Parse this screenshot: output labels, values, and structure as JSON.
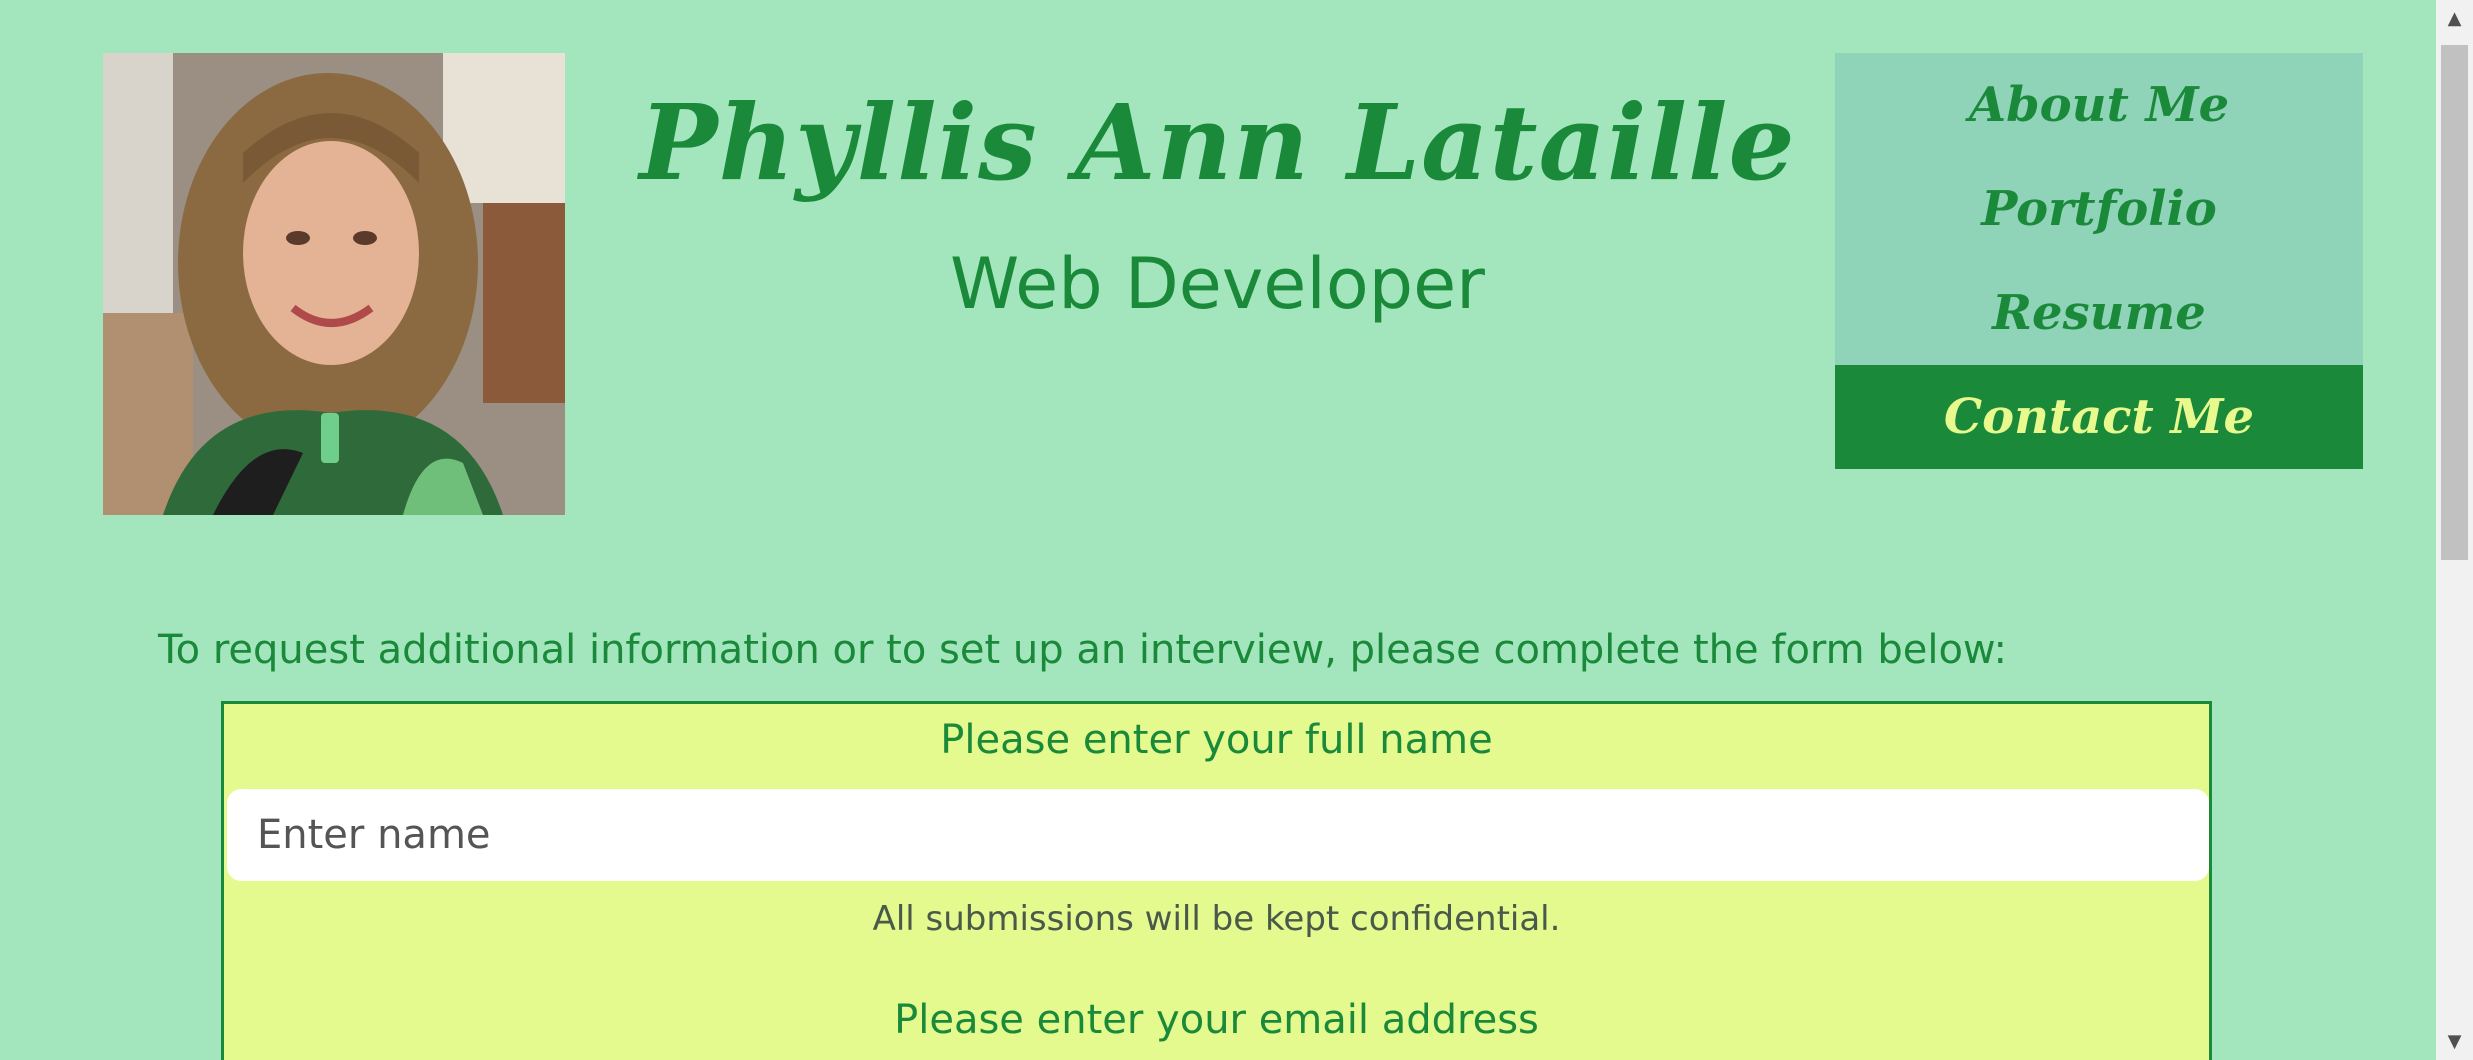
{
  "header": {
    "name": "Phyllis Ann Lataille",
    "role": "Web Developer",
    "photo_alt": "Phyllis Ann Lataille"
  },
  "nav": {
    "items": [
      {
        "label": "About Me",
        "active": false
      },
      {
        "label": "Portfolio",
        "active": false
      },
      {
        "label": "Resume",
        "active": false
      },
      {
        "label": "Contact Me",
        "active": true
      }
    ]
  },
  "intro": {
    "text": "To request additional information or to set up an interview, please complete the form below:"
  },
  "form": {
    "name_label": "Please enter your full name",
    "name_placeholder": "Enter name",
    "name_value": "",
    "help_text": "All submissions will be kept confidential.",
    "email_label": "Please enter your email address"
  },
  "colors": {
    "background": "#a3e6be",
    "accent": "#1a8a3a",
    "nav_bg": "#8fd4b8",
    "form_bg": "#e4f98e",
    "active_text": "#e8f98e"
  },
  "icons": {
    "scroll_up": "▲",
    "scroll_down": "▼"
  }
}
